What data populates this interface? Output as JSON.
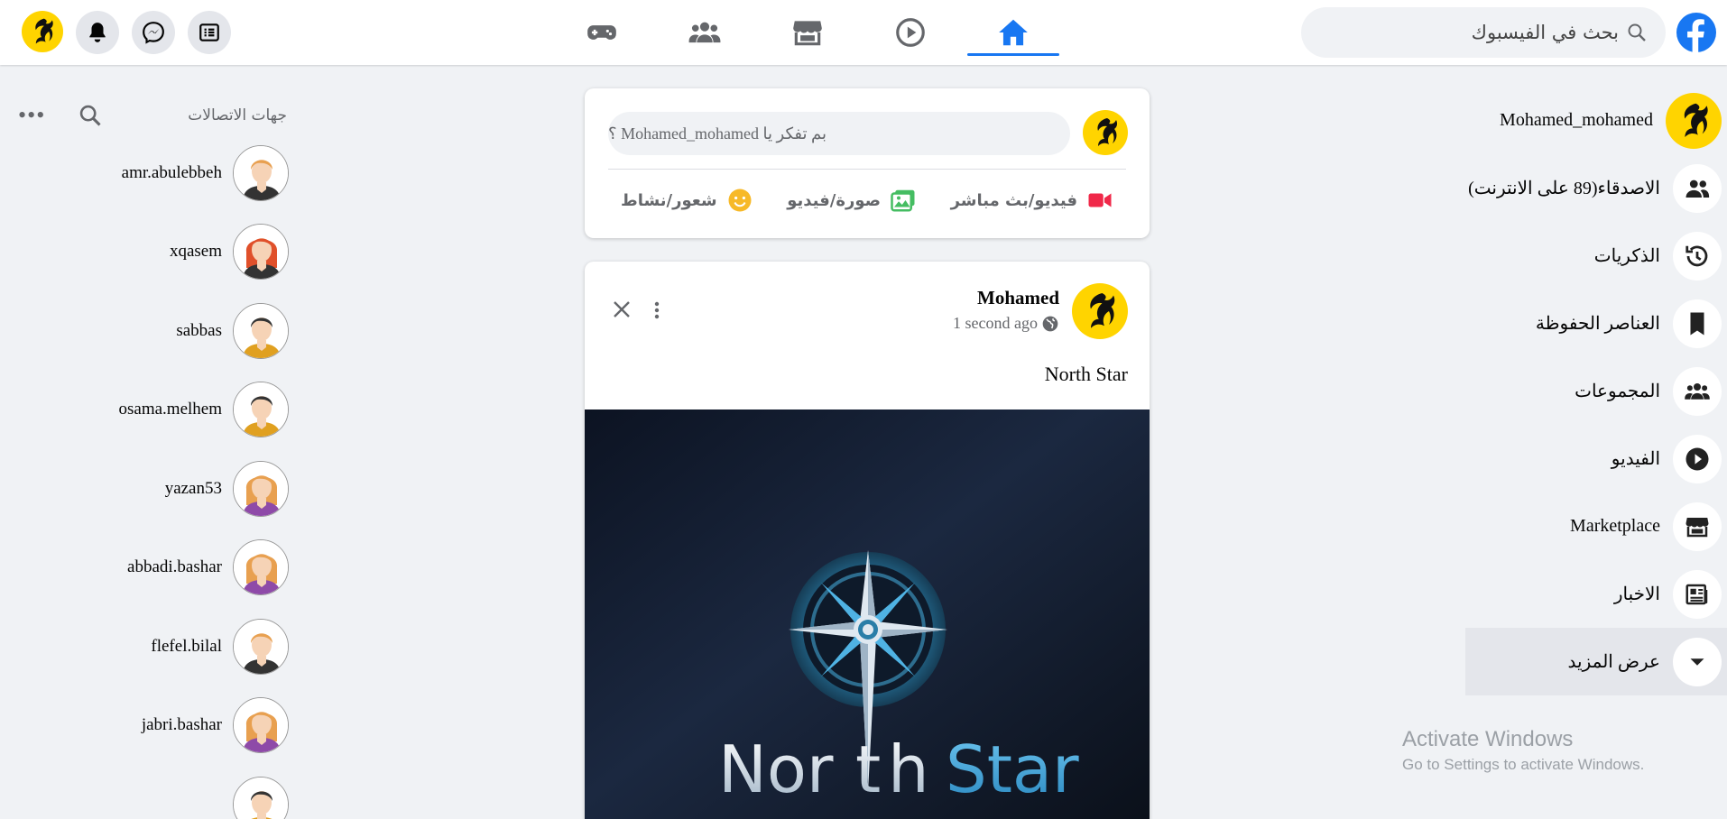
{
  "header": {
    "search_placeholder": "بحث في الفيسبوك",
    "nav_tabs": [
      {
        "name": "home",
        "active": true
      },
      {
        "name": "watch",
        "active": false
      },
      {
        "name": "marketplace",
        "active": false
      },
      {
        "name": "groups",
        "active": false
      },
      {
        "name": "gaming",
        "active": false
      }
    ],
    "left_icons": [
      "menu-icon",
      "messenger-icon",
      "bell-icon",
      "profile-avatar"
    ]
  },
  "sidebar": {
    "items": [
      {
        "label": "Mohamed_mohamed",
        "icon": "profile-avatar"
      },
      {
        "label": "الاصدقاء(89 على الانترنت)",
        "icon": "friends-icon"
      },
      {
        "label": "الذكريات",
        "icon": "memories-icon"
      },
      {
        "label": "العناصر الحفوظة",
        "icon": "bookmark-icon"
      },
      {
        "label": "المجموعات",
        "icon": "groups-icon"
      },
      {
        "label": "الفيديو",
        "icon": "video-icon"
      },
      {
        "label": "Marketplace",
        "icon": "store-icon"
      },
      {
        "label": "الاخبار",
        "icon": "news-icon"
      },
      {
        "label": "عرض المزيد",
        "icon": "chevron-down-icon"
      }
    ]
  },
  "contacts": {
    "title": "جهات الاتصالات",
    "items": [
      {
        "name": "amr.abulebbeh",
        "hair": "#e8a050",
        "shirt": "#333333",
        "female": false
      },
      {
        "name": "xqasem",
        "hair": "#e0502a",
        "shirt": "#333333",
        "female": true
      },
      {
        "name": "sabbas",
        "hair": "#333333",
        "shirt": "#e0a020",
        "female": false
      },
      {
        "name": "osama.melhem",
        "hair": "#333333",
        "shirt": "#e0a020",
        "female": false
      },
      {
        "name": "yazan53",
        "hair": "#e8a050",
        "shirt": "#8e4aa8",
        "female": true
      },
      {
        "name": "abbadi.bashar",
        "hair": "#e8a050",
        "shirt": "#8e4aa8",
        "female": true
      },
      {
        "name": "flefel.bilal",
        "hair": "#e8a050",
        "shirt": "#333333",
        "female": false
      },
      {
        "name": "jabri.bashar",
        "hair": "#e8a050",
        "shirt": "#8e4aa8",
        "female": true
      },
      {
        "name": "",
        "hair": "#333333",
        "shirt": "#e0a020",
        "female": false
      }
    ]
  },
  "composer": {
    "placeholder": "بم تفكر يا Mohamed_mohamed ؟",
    "actions": [
      {
        "label": "فيديو/بث مباشر",
        "icon": "live-video-icon"
      },
      {
        "label": "صورة/فيديو",
        "icon": "photo-icon"
      },
      {
        "label": "شعور/نشاط",
        "icon": "smiley-icon"
      }
    ]
  },
  "post": {
    "author": "Mohamed",
    "time": "1 second ago",
    "text": "North Star",
    "image_text": "North Star"
  },
  "watermark": {
    "line1": "Activate Windows",
    "line2": "Go to Settings to activate Windows."
  },
  "colors": {
    "accent": "#1877f2",
    "avatar_bg": "#ffd400",
    "bg": "#f0f2f5"
  }
}
